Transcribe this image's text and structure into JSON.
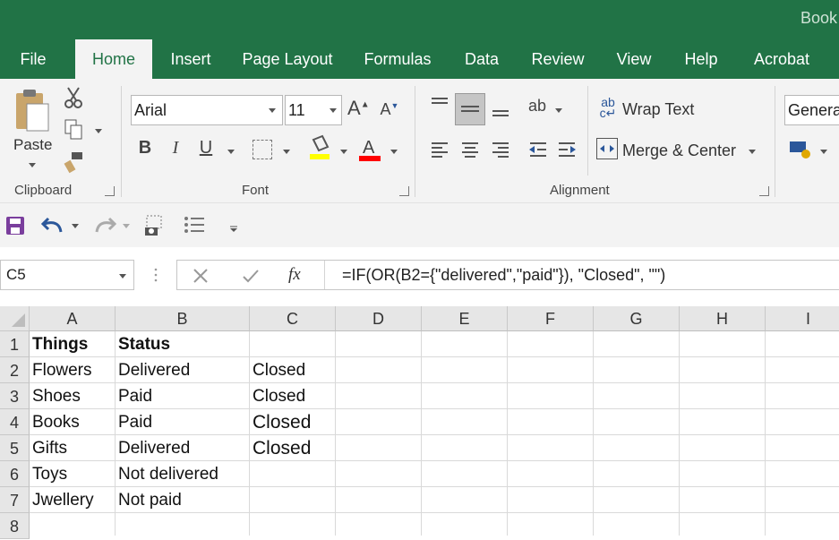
{
  "window": {
    "title": "Book"
  },
  "tabs": [
    "File",
    "Home",
    "Insert",
    "Page Layout",
    "Formulas",
    "Data",
    "Review",
    "View",
    "Help",
    "Acrobat"
  ],
  "active_tab": "Home",
  "ribbon": {
    "clipboard": {
      "paste_label": "Paste",
      "group_label": "Clipboard"
    },
    "font": {
      "font_name": "Arial",
      "font_size": "11",
      "group_label": "Font",
      "highlight_color": "#ffff00",
      "font_color": "#ff0000"
    },
    "alignment": {
      "wrap_text_label": "Wrap Text",
      "merge_center_label": "Merge & Center",
      "group_label": "Alignment"
    },
    "number": {
      "format_value": "General"
    }
  },
  "formula_bar": {
    "name_box": "C5",
    "fx_label": "fx",
    "formula": "=IF(OR(B2={\"delivered\",\"paid\"}), \"Closed\", \"\")"
  },
  "sheet": {
    "columns": [
      "A",
      "B",
      "C",
      "D",
      "E",
      "F",
      "G",
      "H",
      "I"
    ],
    "row_numbers": [
      "1",
      "2",
      "3",
      "4",
      "5",
      "6",
      "7",
      "8"
    ],
    "rows": [
      [
        "Things",
        "Status",
        ""
      ],
      [
        "Flowers",
        "Delivered",
        "Closed"
      ],
      [
        "Shoes",
        "Paid",
        "Closed"
      ],
      [
        "Books",
        "Paid",
        "Closed"
      ],
      [
        "Gifts",
        "Delivered",
        "Closed"
      ],
      [
        "Toys",
        "Not delivered",
        ""
      ],
      [
        "Jwellery",
        "Not paid",
        ""
      ],
      [
        "",
        "",
        ""
      ]
    ]
  },
  "colors": {
    "brand": "#217346",
    "ribbon_bg": "#f3f3f3",
    "header_bg": "#e6e6e6"
  }
}
